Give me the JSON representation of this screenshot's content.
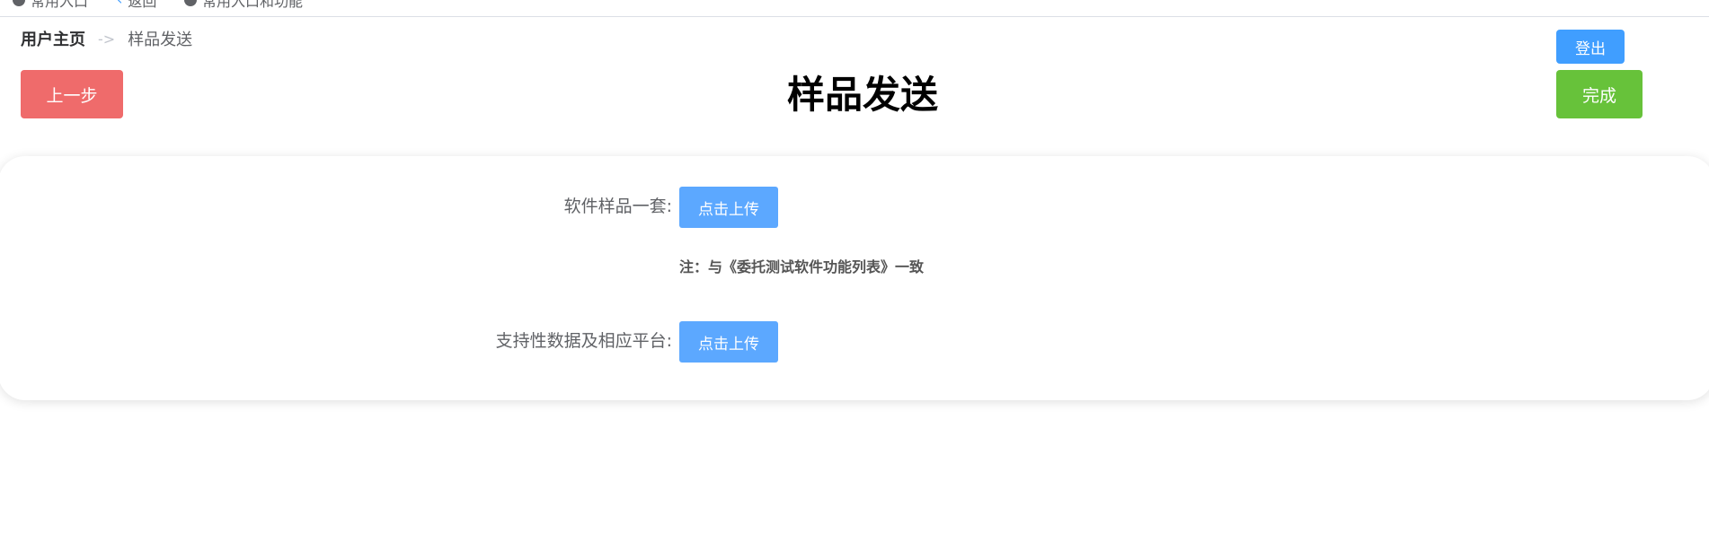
{
  "top_tabs": [
    {
      "label": "常用入口",
      "icon": "circle-icon"
    },
    {
      "label": "返回",
      "icon": "back-arrow-icon"
    },
    {
      "label": "常用入口和功能",
      "icon": "circle-icon"
    }
  ],
  "breadcrumb": {
    "home": "用户主页",
    "separator": "->",
    "current": "样品发送"
  },
  "header": {
    "title": "样品发送",
    "logout_label": "登出",
    "prev_label": "上一步",
    "finish_label": "完成"
  },
  "form": {
    "software_sample_label": "软件样品一套:",
    "software_sample_button": "点击上传",
    "note": "注：与《委托测试软件功能列表》一致",
    "support_data_label": "支持性数据及相应平台:",
    "support_data_button": "点击上传"
  },
  "colors": {
    "primary": "#409eff",
    "danger": "#ef6b6b",
    "success": "#67c23a"
  }
}
